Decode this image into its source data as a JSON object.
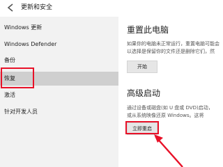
{
  "window": {
    "title": "更新和安全"
  },
  "sidebar": {
    "items": [
      {
        "label": "Windows 更新"
      },
      {
        "label": "Windows Defender"
      },
      {
        "label": "备份"
      },
      {
        "label": "恢复"
      },
      {
        "label": "激活"
      },
      {
        "label": "针对开发人员"
      }
    ]
  },
  "reset": {
    "title": "重置此电脑",
    "desc_line1": "如果你的电脑未正常运行，重置电脑可能会",
    "desc_line2": "以选择是保留你的文件还是删除它们，然",
    "button": "开始"
  },
  "advanced": {
    "title": "高级启动",
    "desc_line1": "通过设备或磁盘(如 U 盘或 DVD)启动，",
    "desc_line2": "或从系统映像还原 Windows。这将",
    "button": "立即重启"
  },
  "colors": {
    "highlight": "#e81128",
    "sidebar_bg": "#f2f2f2",
    "active_bg": "#cfcfcf"
  }
}
